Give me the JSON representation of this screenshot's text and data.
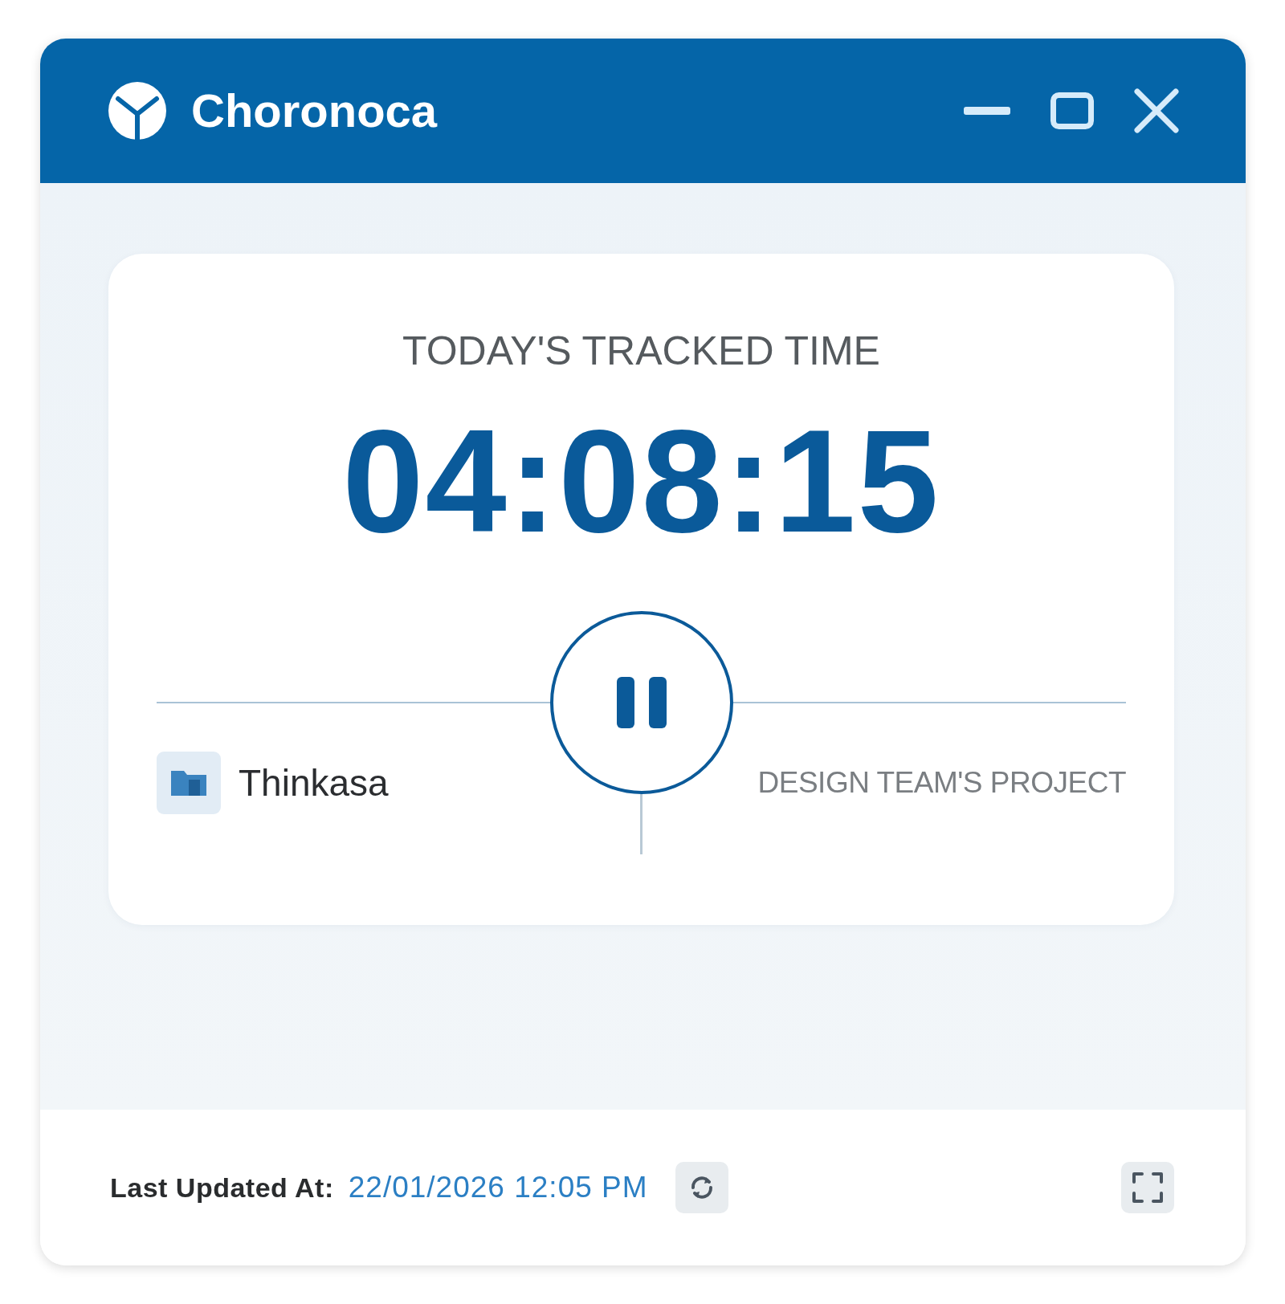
{
  "window": {
    "title": "Choronoca"
  },
  "tracker": {
    "heading": "TODAY'S TRACKED TIME",
    "time": "04:08:15",
    "running": true,
    "workspace": "Thinkasa",
    "project": "DESIGN TEAM'S PROJECT"
  },
  "footer": {
    "label": "Last Updated At:",
    "timestamp": "22/01/2026 12:05 PM"
  }
}
